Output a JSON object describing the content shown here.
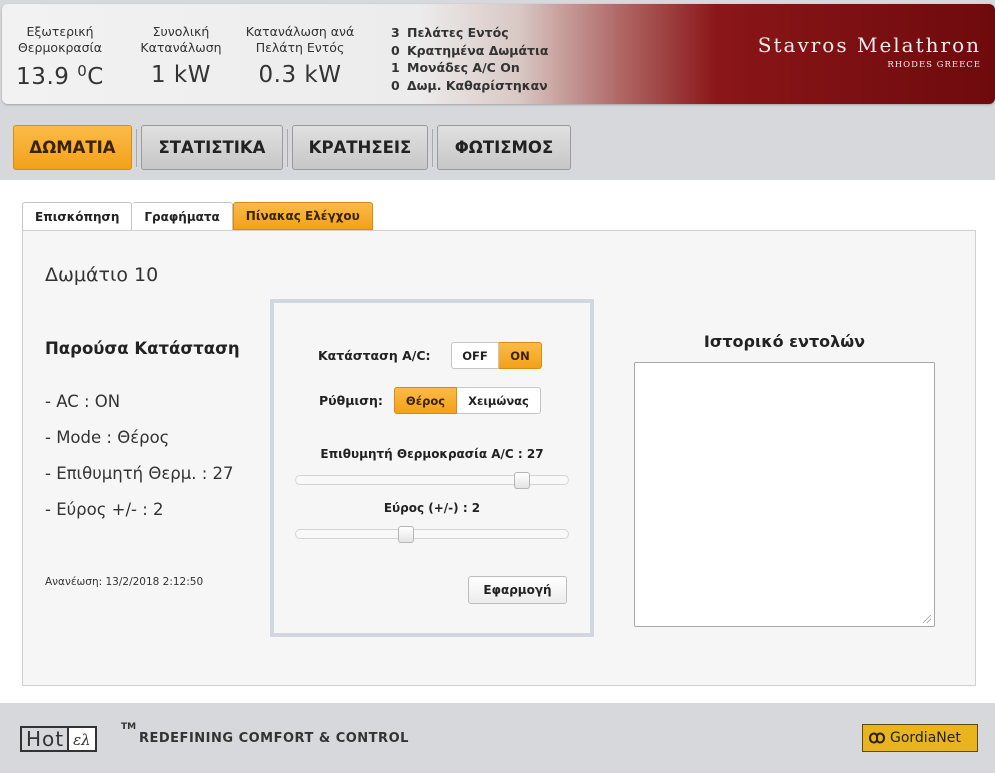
{
  "header": {
    "outside_temp": {
      "label_line1": "Εξωτερική",
      "label_line2": "Θερμοκρασία",
      "value": "13.9 ",
      "unit_sup": "0",
      "unit": "C"
    },
    "total_consumption": {
      "label_line1": "Συνολική",
      "label_line2": "Κατανάλωση",
      "value": "1 kW"
    },
    "per_guest": {
      "label_line1": "Κατανάλωση ανά",
      "label_line2": "Πελάτη Εντός",
      "value": "0.3 kW"
    },
    "counters": [
      {
        "n": "3",
        "label": "Πελάτες Εντός"
      },
      {
        "n": "0",
        "label": "Κρατημένα Δωμάτια"
      },
      {
        "n": "1",
        "label": "Μονάδες A/C On"
      },
      {
        "n": "0",
        "label": "Δωμ. Καθαρίστηκαν"
      }
    ],
    "brand_name": "Stavros Melathron",
    "brand_sub": "RHODES GREECE"
  },
  "nav": {
    "rooms": "ΔΩΜΑΤΙΑ",
    "stats": "ΣΤΑΤΙΣΤΙΚΑ",
    "bookings": "ΚΡΑΤΗΣΕΙΣ",
    "lighting": "ΦΩΤΙΣΜΟΣ"
  },
  "subtabs": {
    "overview": "Επισκόπηση",
    "graphs": "Γραφήματα",
    "control": "Πίνακας Ελέγχου"
  },
  "room": {
    "title": "Δωμάτιο 10",
    "current_title": "Παρούσα Κατάσταση",
    "ac_line": "- AC : ON",
    "mode_line": "- Mode : Θέρος",
    "target_line": "- Επιθυμητή Θερμ. : 27",
    "range_line": "- Εύρος +/- : 2",
    "updated": "Ανανέωση: 13/2/2018 2:12:50"
  },
  "control": {
    "ac_state_label": "Κατάσταση A/C:",
    "off_label": "OFF",
    "on_label": "ON",
    "setting_label": "Ρύθμιση:",
    "summer_label": "Θέρος",
    "winter_label": "Χειμώνας",
    "target_label": "Επιθυμητή Θερμοκρασία A/C : 27",
    "target_level": 0.85,
    "range_label": "Εύρος (+/-) : 2",
    "range_level": 0.4,
    "apply_label": "Εφαρμογή"
  },
  "history": {
    "title": "Ιστορικό εντολών",
    "content": ""
  },
  "footer": {
    "logo_hot": "Hot",
    "logo_el": "ελ",
    "logo_tm": "TM",
    "tagline": "REDEFINING COMFORT & CONTROL",
    "partner": "GordiaNet"
  }
}
